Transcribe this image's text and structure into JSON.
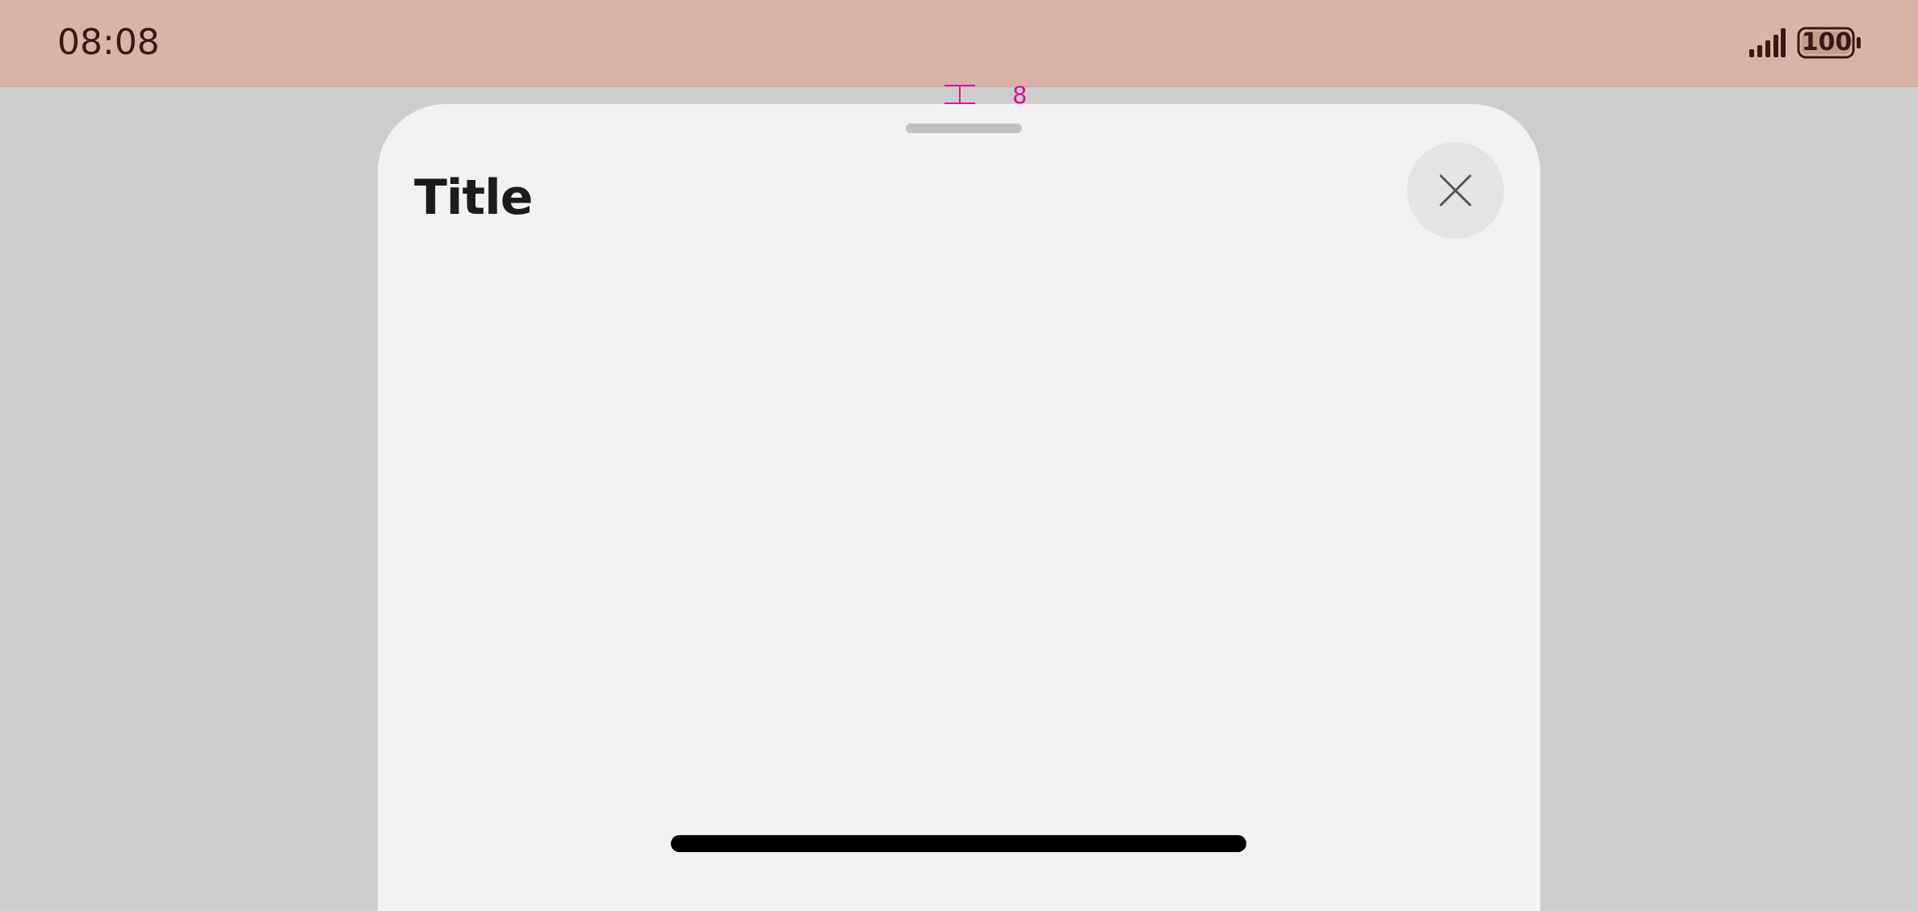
{
  "status_bar": {
    "time": "08:08",
    "signal_icon": "cellular-signal-icon",
    "battery_icon": "battery-icon",
    "battery_level": "100"
  },
  "spacing_annotation": {
    "icon": "spacing-measure-icon",
    "value": "8",
    "color": "#e0119a"
  },
  "sheet": {
    "title": "Title",
    "close_icon": "close-icon",
    "background": "#f2f2f2"
  },
  "colors": {
    "status_bar_bg": "#d8b3a6",
    "scrim": "#cdcdcd",
    "status_text": "#3a1712"
  }
}
